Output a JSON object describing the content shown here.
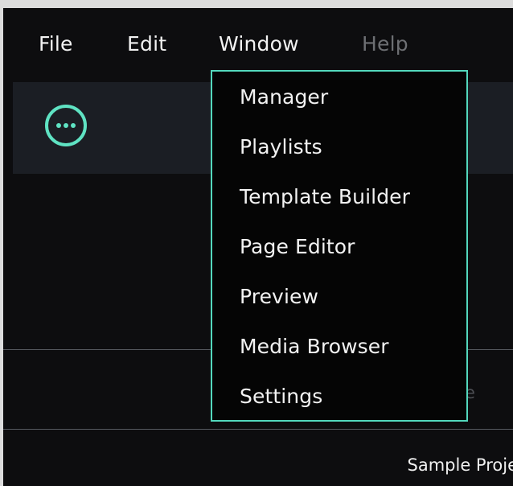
{
  "menubar": {
    "file": "File",
    "edit": "Edit",
    "window": "Window",
    "help": "Help"
  },
  "window_menu": {
    "items": [
      "Manager",
      "Playlists",
      "Template Builder",
      "Page Editor",
      "Preview",
      "Media Browser",
      "Settings"
    ]
  },
  "toolbar": {
    "more_icon": "more-options-icon"
  },
  "status": {
    "project_name": "Sample Proje",
    "obscured_fragment": "e"
  },
  "colors": {
    "accent": "#5fe3c3",
    "background": "#0d0d0f",
    "panel": "#1b1e24",
    "disabled_text": "#6d6f73"
  }
}
